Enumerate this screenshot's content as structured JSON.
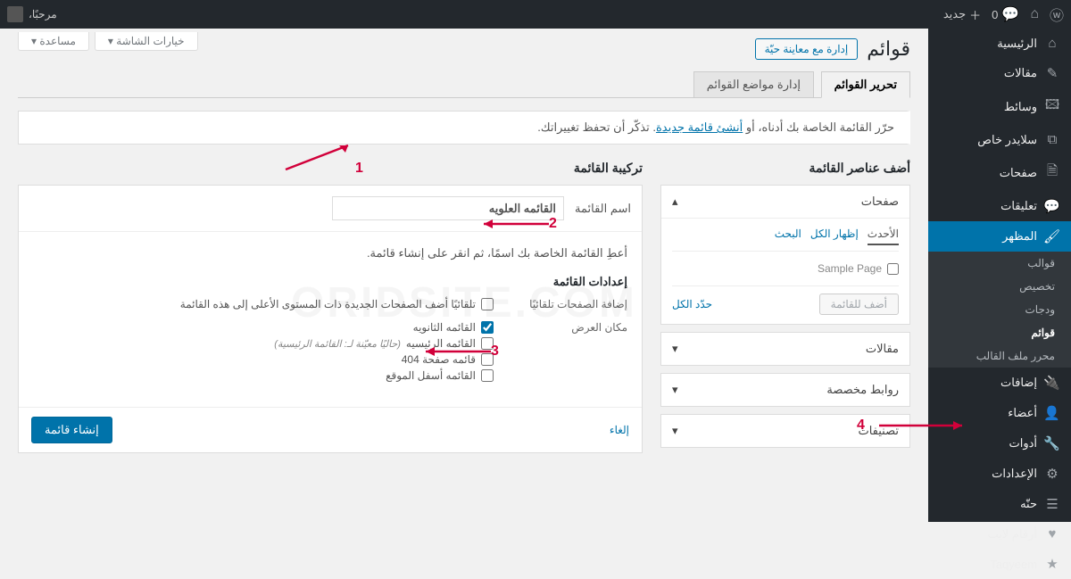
{
  "adminbar": {
    "greeting": "مرحبًا،",
    "new": "جديد",
    "comments": "0"
  },
  "sidebar": {
    "items": [
      {
        "icon": "⌂",
        "label": "الرئيسية"
      },
      {
        "icon": "✎",
        "label": "مقالات"
      },
      {
        "icon": "🖾",
        "label": "وسائط"
      },
      {
        "icon": "⧉",
        "label": "سلايدر خاص"
      },
      {
        "icon": "🗎",
        "label": "صفحات"
      },
      {
        "icon": "💬",
        "label": "تعليقات"
      },
      {
        "icon": "🖌",
        "label": "المظهر",
        "active": true
      },
      {
        "icon": "🔌",
        "label": "إضافات"
      },
      {
        "icon": "👤",
        "label": "أعضاء"
      },
      {
        "icon": "🔧",
        "label": "أدوات"
      },
      {
        "icon": "⚙",
        "label": "الإعدادات"
      },
      {
        "icon": "☰",
        "label": "حنّه"
      },
      {
        "icon": "♥",
        "label": "أرقام لايت"
      },
      {
        "icon": "★",
        "label": "Taqyeem"
      }
    ],
    "submenu": [
      "قوالب",
      "تخصيص",
      "ودجات",
      "قوائم",
      "محرر ملف القالب"
    ],
    "submenu_current": "قوائم"
  },
  "page": {
    "title": "قوائم",
    "live_btn": "إدارة مع معاينة حيّة",
    "screen_opts": "خيارات الشاشة",
    "help": "مساعدة"
  },
  "tabs": {
    "edit": "تحرير القوائم",
    "locations": "إدارة مواضع القوائم"
  },
  "notice": {
    "pre": "حرّر القائمة الخاصة بك أدناه، أو ",
    "link": "أنشئ قائمة جديدة",
    "post": ". تذكّر أن تحفظ تغييراتك."
  },
  "side": {
    "title": "أضف عناصر القائمة",
    "acc_pages": "صفحات",
    "tab_recent": "الأحدث",
    "tab_all": "إظهار الكل",
    "tab_search": "البحث",
    "sample": "Sample Page",
    "select_all": "حدّد الكل",
    "add_btn": "أضف للقائمة",
    "acc_posts": "مقالات",
    "acc_links": "روابط مخصصة",
    "acc_cats": "تصنيفات"
  },
  "structure": {
    "title": "تركيبة القائمة",
    "name_label": "اسم القائمة",
    "name_value": "القائمه العلويه",
    "hint": "أعطِ القائمة الخاصة بك اسمًا، ثم انقر على إنشاء قائمة.",
    "settings_title": "إعدادات القائمة",
    "auto_add_label": "إضافة الصفحات تلقائيًا",
    "auto_add_opt": "تلقائيًا أضف الصفحات الجديدة ذات المستوى الأعلى إلى هذه القائمة",
    "loc_label": "مكان العرض",
    "loc1": "القائمه الثانويه",
    "loc2": "القائمه الرئيسيه",
    "loc2_note": "(حاليًا معيّنة لـ: القائمة الرئيسية)",
    "loc3": "قائمه صفحة 404",
    "loc4": "القائمه أسفل الموقع",
    "cancel": "إلغاء",
    "create": "إنشاء قائمة"
  },
  "anno": {
    "a1": "1",
    "a2": "2",
    "a3": "3",
    "a4": "4"
  },
  "watermark": "ORIDSITE.COM"
}
